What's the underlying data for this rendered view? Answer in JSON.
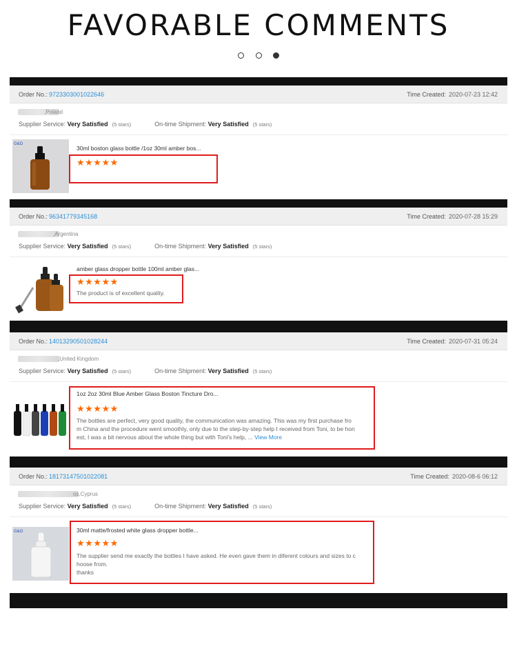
{
  "page": {
    "headline": "FAVORABLE COMMENTS",
    "carousel_dots": 3,
    "active_dot": 3
  },
  "labels": {
    "order_no": "Order No.:",
    "time_created": "Time Created:",
    "supplier_service": "Supplier Service:",
    "ontime_shipment": "On-time Shipment:",
    "rating_value": "Very Satisfied",
    "rating_stars": "(5 stars)",
    "view_more": "View More"
  },
  "colors": {
    "accent_link": "#2a8fd8",
    "star": "#ff6a00",
    "highlight_box": "#e01b1b"
  },
  "orders": [
    {
      "order_no": "9723303001022646",
      "time_created": "2020-07-23 12:42",
      "country": ",Poland",
      "product_title": "30ml boston glass bottle /1oz 30ml amber bos...",
      "stars": "★★★★★",
      "review": "",
      "thumb_badge": "G&O",
      "thumb": "amber-dropper-bottle"
    },
    {
      "order_no": "96341779345168",
      "time_created": "2020-07-28 15:29",
      "country": ",Argentina",
      "product_title": "amber glass dropper bottle 100ml amber glas...",
      "stars": "★★★★★",
      "review": "The product is of excellent quality.",
      "thumb": "two-amber-bottles"
    },
    {
      "order_no": "14013290501028244",
      "time_created": "2020-07-31 05:24",
      "country": ",United Kingdom",
      "product_title": "1oz 2oz 30ml Blue Amber Glass Boston Tincture Dro...",
      "stars": "★★★★★",
      "review_lines": [
        "The bottles are perfect, very good quality, the communication was amazing. This was my first purchase fro",
        "m China and the procedure went smoothly, only due to the step-by-step help I received from Toni, to be hon",
        "est, I was a bit nervous about the whole thing but with Toni's help, ..."
      ],
      "thumb": "colored-bottles-row"
    },
    {
      "order_no": "18173147501022081",
      "time_created": "2020-08-6 06:12",
      "country": "os,Cyprus",
      "product_title": "30ml matte/frosted white glass dropper bottle...",
      "stars": "★★★★★",
      "review_lines": [
        "The supplier send me exactly the bottles I have asked. He even gave them in diferent colours and sizes to c",
        "hoose from.",
        "thanks"
      ],
      "thumb_badge": "G&O",
      "thumb": "white-dropper-bottle"
    }
  ]
}
